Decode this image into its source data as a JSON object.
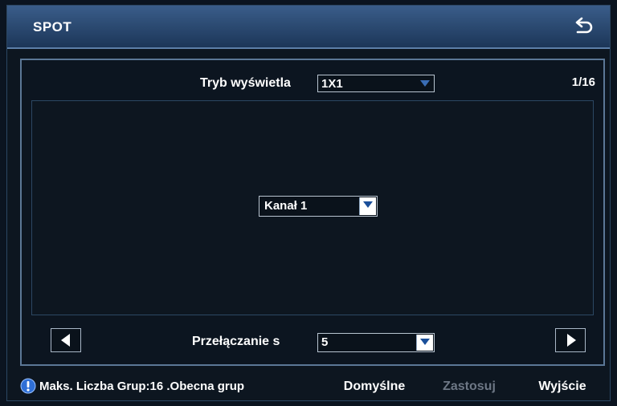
{
  "window": {
    "title": "SPOT"
  },
  "display_mode": {
    "label": "Tryb wyświetla",
    "value": "1X1",
    "options": [
      "1X1"
    ]
  },
  "page_indicator": "1/16",
  "channel_select": {
    "value": "Kanał 1"
  },
  "switching": {
    "label": "Przełączanie s",
    "value": "5"
  },
  "footer": {
    "info_text": "Maks. Liczba Grup:16 .Obecna grup",
    "default_label": "Domyślne",
    "apply_label": "Zastosuj",
    "exit_label": "Wyjście"
  },
  "icons": {
    "back": "back-arrow-icon",
    "info": "info-icon",
    "prev": "arrow-left-icon",
    "next": "arrow-right-icon",
    "dropdown": "chevron-down-icon"
  },
  "colors": {
    "titlebar_top": "#3a5d8a",
    "titlebar_bottom": "#1c3658",
    "background": "#0d1620",
    "frame_border": "#5b7796",
    "caret_arrow": "#1a4f9a",
    "disabled_text": "#6d7785"
  }
}
